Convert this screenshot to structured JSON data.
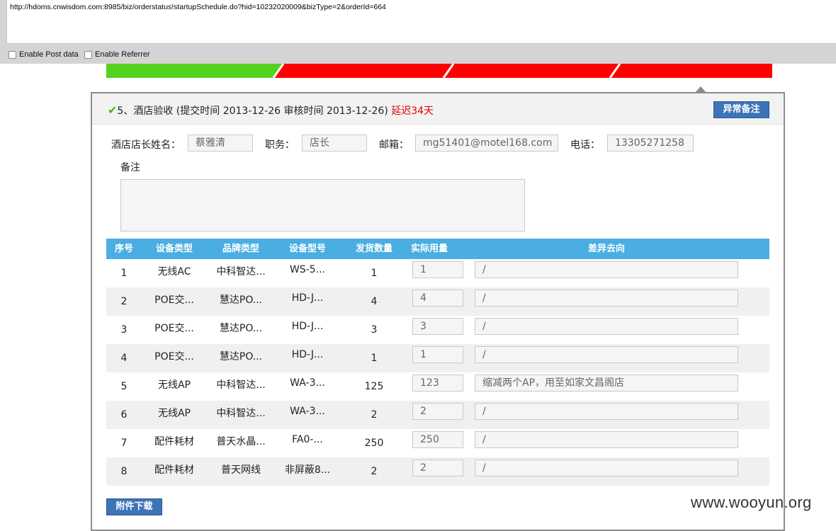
{
  "browser": {
    "url": "http://hdoms.cnwisdom.com:8985/biz/orderstatus!startupSchedule.do?hid=10232020009&bizType=2&orderId=664",
    "enable_post_label": "Enable Post data",
    "enable_referrer_label": "Enable Referrer"
  },
  "steps": {
    "colors": {
      "done": "#55d11f",
      "pending": "#ff0000"
    }
  },
  "section": {
    "check_icon": "✔",
    "title": "5、酒店验收",
    "submit_info": "(提交时间 2013-12-26  审核时间 2013-12-26)",
    "delay": "延迟34天",
    "abnormal_button": "异常备注"
  },
  "form": {
    "manager_label": "酒店店长姓名：",
    "manager_value": "蔡雅清",
    "position_label": "职务：",
    "position_value": "店长",
    "email_label": "邮箱：",
    "email_value": "mg51401@motel168.com",
    "phone_label": "电话：",
    "phone_value": "13305271258",
    "remark_label": "备注",
    "remark_value": ""
  },
  "table": {
    "headers": [
      "序号",
      "设备类型",
      "品牌类型",
      "设备型号",
      "发货数量",
      "实际用量",
      "差异去向"
    ],
    "rows": [
      {
        "no": "1",
        "type": "无线AC",
        "brand": "中科智达...",
        "model": "WS-5...",
        "shipped": "1",
        "actual": "1",
        "diff": "/"
      },
      {
        "no": "2",
        "type": "POE交...",
        "brand": "慧达PO...",
        "model": "HD-J...",
        "shipped": "4",
        "actual": "4",
        "diff": "/"
      },
      {
        "no": "3",
        "type": "POE交...",
        "brand": "慧达PO...",
        "model": "HD-J...",
        "shipped": "3",
        "actual": "3",
        "diff": "/"
      },
      {
        "no": "4",
        "type": "POE交...",
        "brand": "慧达PO...",
        "model": "HD-J...",
        "shipped": "1",
        "actual": "1",
        "diff": "/"
      },
      {
        "no": "5",
        "type": "无线AP",
        "brand": "中科智达...",
        "model": "WA-3...",
        "shipped": "125",
        "actual": "123",
        "diff": "缩减两个AP，用至如家文昌阁店"
      },
      {
        "no": "6",
        "type": "无线AP",
        "brand": "中科智达...",
        "model": "WA-3...",
        "shipped": "2",
        "actual": "2",
        "diff": "/"
      },
      {
        "no": "7",
        "type": "配件耗材",
        "brand": "普天水晶...",
        "model": "FA0-...",
        "shipped": "250",
        "actual": "250",
        "diff": "/"
      },
      {
        "no": "8",
        "type": "配件耗材",
        "brand": "普天网线",
        "model": "非屏蔽8...",
        "shipped": "2",
        "actual": "2",
        "diff": "/"
      }
    ]
  },
  "download_button": "附件下载",
  "watermark": "www.wooyun.org"
}
